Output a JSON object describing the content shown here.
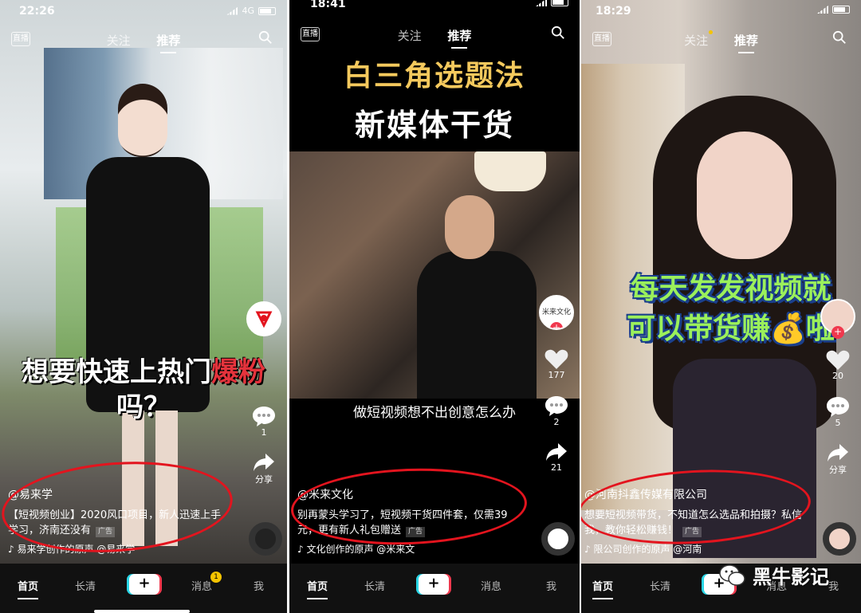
{
  "panels": [
    {
      "status": {
        "time": "22:26",
        "network": "4G"
      },
      "topnav": {
        "live": "直播",
        "tabs": [
          "关注",
          "推荐"
        ]
      },
      "caption_line1": "想要快速上热门",
      "caption_red": "爆粉",
      "caption_line2": "吗？",
      "rail": {
        "comments": "1",
        "share": "分享"
      },
      "info": {
        "author": "@易来学",
        "text": "【短视频创业】2020风口项目，新人迅速上手学习，济南还没有",
        "ad": "广告",
        "music": "易来学创作的原声   @易来学"
      },
      "bottombar": {
        "home": "首页",
        "long": "长清",
        "plus": "+",
        "messages": "消息",
        "message_badge": "1",
        "me": "我"
      }
    },
    {
      "status": {
        "time": "18:41"
      },
      "topnav": {
        "live": "直播",
        "tabs": [
          "关注",
          "推荐"
        ]
      },
      "title_yellow": "白三角选题法",
      "title_white": "新媒体干货",
      "subtitle": "做短视频想不出创意怎么办",
      "avatar_text": "米来文化",
      "rail": {
        "likes": "177",
        "comments": "2",
        "shares": "21"
      },
      "info": {
        "author": "@米来文化",
        "text": "别再蒙头学习了，短视频干货四件套，仅需39元，更有新人礼包赠送",
        "ad": "广告",
        "music": "文化创作的原声   @米来文"
      },
      "bottombar": {
        "home": "首页",
        "long": "长清",
        "plus": "+",
        "messages": "消息",
        "me": "我"
      }
    },
    {
      "status": {
        "time": "18:29"
      },
      "topnav": {
        "live": "直播",
        "tabs": [
          "关注",
          "推荐"
        ]
      },
      "caption_line1": "每天发发视频就",
      "caption_line2": "可以带货赚💰啦",
      "rail": {
        "likes": "20",
        "comments": "5",
        "share": "分享"
      },
      "info": {
        "author": "@河南抖鑫传媒有限公司",
        "text": "想要短视频带货，不知道怎么选品和拍摄？私信我，教你轻松赚钱！",
        "ad": "广告",
        "music": "限公司创作的原声   @河南"
      },
      "bottombar": {
        "home": "首页",
        "long": "长清",
        "plus": "+",
        "messages": "消息",
        "me": "我"
      }
    }
  ],
  "watermark": "黑牛影记",
  "colors": {
    "annotation": "#e3141e",
    "title_yellow": "#f4c95d",
    "caption_green": "#9bf05b",
    "accent_red": "#f0384d"
  }
}
